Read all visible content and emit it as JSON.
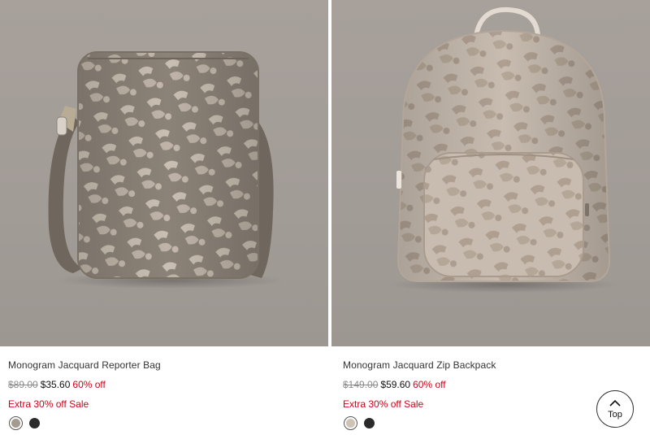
{
  "products": [
    {
      "name": "Monogram Jacquard Reporter Bag",
      "original_price": "$89.00",
      "sale_price": "$35.60",
      "discount": "60% off",
      "promo": "Extra 30% off Sale",
      "image_icon": "reporter-bag-image",
      "swatches": [
        "#a49a8e",
        "#2b2b2b"
      ]
    },
    {
      "name": "Monogram Jacquard Zip Backpack",
      "original_price": "$149.00",
      "sale_price": "$59.60",
      "discount": "60% off",
      "promo": "Extra 30% off Sale",
      "image_icon": "zip-backpack-image",
      "swatches": [
        "#cfc3b6",
        "#2b2b2b"
      ]
    }
  ],
  "back_to_top": {
    "label": "Top",
    "icon": "chevron-up-icon"
  },
  "colors": {
    "sale_red": "#d0021b",
    "photo_bg": "#a39d98"
  }
}
